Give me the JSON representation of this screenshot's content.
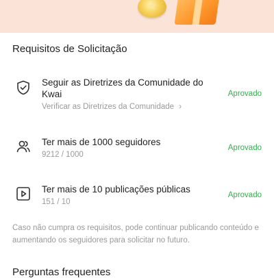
{
  "header_section": {
    "title": "Requisitos de Solicitação"
  },
  "requirements": [
    {
      "title": "Seguir as Diretrizes da Comunidade do Kwai",
      "sub": "Verificar as Diretrizes da Comunidade",
      "sub_chevron": "›",
      "status": "Aprovado",
      "icon": "shield-check-icon"
    },
    {
      "title": "Ter mais de 1000 seguidores",
      "sub": "9212 / 1000",
      "status": "Aprovado",
      "icon": "users-icon"
    },
    {
      "title": "Ter mais de 10 publicações públicas",
      "sub": "151 / 10",
      "status": "Aprovado",
      "icon": "play-icon"
    }
  ],
  "note": "Caso não cumpra os requisitos, pode continuar publicando conteúdo e aumentando os seguidores para solicitar no futuro.",
  "faq": {
    "title": "Perguntas frequentes"
  },
  "colors": {
    "approved": "#2fb34a",
    "banner": "#fbe3d8",
    "muted_text": "#9a9a9a"
  }
}
